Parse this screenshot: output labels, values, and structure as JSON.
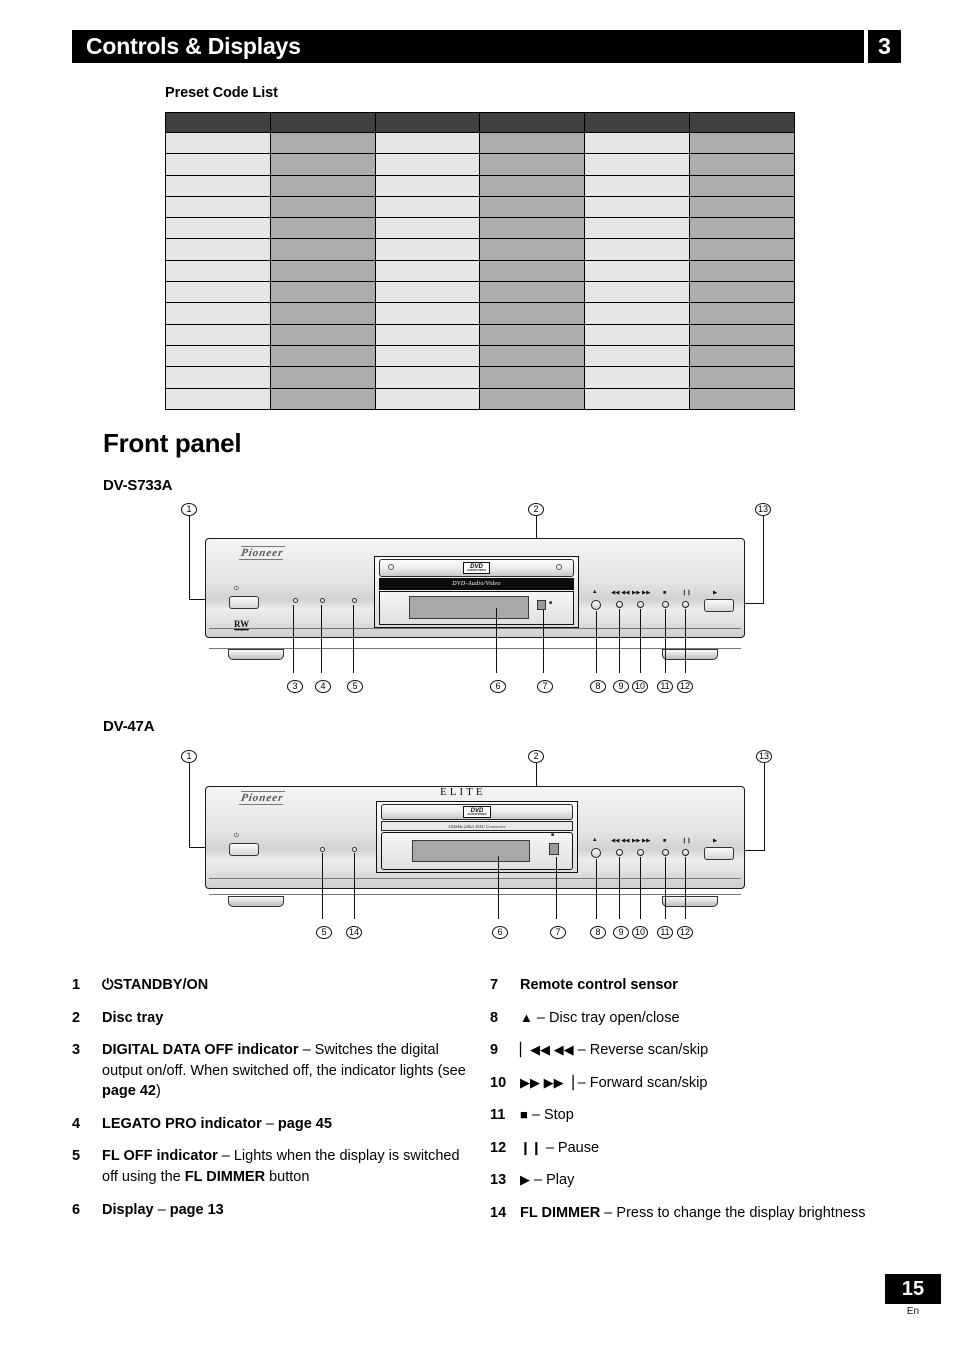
{
  "header": {
    "title": "Controls & Displays",
    "chapter": "3"
  },
  "preset": {
    "title": "Preset Code List",
    "table": {
      "columns": 6,
      "header_row_cells": [
        "",
        "",
        "",
        "",
        "",
        ""
      ],
      "body_rows": [
        [
          "",
          "",
          "",
          "",
          "",
          ""
        ],
        [
          "",
          "",
          "",
          "",
          "",
          ""
        ],
        [
          "",
          "",
          "",
          "",
          "",
          ""
        ],
        [
          "",
          "",
          "",
          "",
          "",
          ""
        ],
        [
          "",
          "",
          "",
          "",
          "",
          ""
        ],
        [
          "",
          "",
          "",
          "",
          "",
          ""
        ],
        [
          "",
          "",
          "",
          "",
          "",
          ""
        ],
        [
          "",
          "",
          "",
          "",
          "",
          ""
        ],
        [
          "",
          "",
          "",
          "",
          "",
          ""
        ],
        [
          "",
          "",
          "",
          "",
          "",
          ""
        ],
        [
          "",
          "",
          "",
          "",
          "",
          ""
        ],
        [
          "",
          "",
          "",
          "",
          "",
          ""
        ],
        [
          "",
          "",
          "",
          "",
          "",
          ""
        ]
      ]
    },
    "colors": {
      "header_fill": "#414141",
      "light_fill": "#e6e6e6",
      "dark_fill": "#adadad",
      "border": "#000000"
    }
  },
  "section": {
    "heading": "Front panel",
    "model_1": "DV-S733A",
    "model_2": "DV-47A"
  },
  "diagram_1": {
    "brand": "Pioneer",
    "tray_badge": "DVD",
    "tray_badge_sub": "AUDIO/VIDEO",
    "strip_text": "DVD-Audio/Video",
    "rw_label": "RW",
    "rw_sub": "compatible",
    "power_symbol": "⏻",
    "symbols": {
      "eject": "▲",
      "reverse": "◀◀ ◀◀",
      "forward": "▶▶ ▶▶",
      "stop": "■",
      "pause": "❙❙",
      "play": "▶"
    },
    "callouts_top": [
      "1",
      "2",
      "13"
    ],
    "callouts_bottom": [
      "3",
      "4",
      "5",
      "6",
      "7",
      "8",
      "9",
      "10",
      "11",
      "12"
    ]
  },
  "diagram_2": {
    "brand": "Pioneer",
    "elite": "ELITE",
    "tray_badge": "DVD",
    "tray_badge_sub": "AUDIO/VIDEO",
    "strip_text": "192kHz 24bit DAC Converter",
    "power_symbol": "⏻",
    "symbols": {
      "eject": "▲",
      "reverse": "◀◀ ◀◀",
      "forward": "▶▶ ▶▶",
      "stop": "■",
      "pause": "❙❙",
      "play": "▶"
    },
    "callouts_top": [
      "1",
      "2",
      "13"
    ],
    "callouts_bottom": [
      "5",
      "14",
      "6",
      "7",
      "8",
      "9",
      "10",
      "11",
      "12"
    ]
  },
  "reference_left": [
    {
      "num": "1",
      "html": "<b>⏻STANDBY/ON</b>"
    },
    {
      "num": "2",
      "html": "<b>Disc tray</b>"
    },
    {
      "num": "3",
      "html": "<b>DIGITAL DATA OFF indicator</b> – Switches the digital output on/off. When switched off, the indicator lights (see <b>page 42</b>)"
    },
    {
      "num": "4",
      "html": "<b>LEGATO PRO indicator</b> – <b>page 45</b>"
    },
    {
      "num": "5",
      "html": "<b>FL OFF indicator</b> – Lights when the display is switched off using the <b>FL DIMMER</b> button"
    },
    {
      "num": "6",
      "html": "<b>Display</b> – <b>page 13</b>"
    }
  ],
  "reference_right": [
    {
      "num": "7",
      "html": "<b>Remote control sensor</b>"
    },
    {
      "num": "8",
      "html": "<span class=\"sym-ico\">▲</span> – Disc tray open/close"
    },
    {
      "num": "9",
      "html": "<span class=\"sym-ico\">▏◀◀ ◀◀</span> – Reverse scan/skip"
    },
    {
      "num": "10",
      "html": "<span class=\"sym-ico\">▶▶ ▶▶▕</span> – Forward scan/skip"
    },
    {
      "num": "11",
      "html": "<span class=\"sym-ico\">■</span> – Stop"
    },
    {
      "num": "12",
      "html": "<span class=\"sym-ico\">❙❙</span> – Pause"
    },
    {
      "num": "13",
      "html": "<span class=\"sym-ico\">▶</span> – Play"
    },
    {
      "num": "14",
      "html": "<b>FL DIMMER</b> – Press to change the display brightness"
    }
  ],
  "footer": {
    "page_number": "15",
    "language": "En"
  }
}
